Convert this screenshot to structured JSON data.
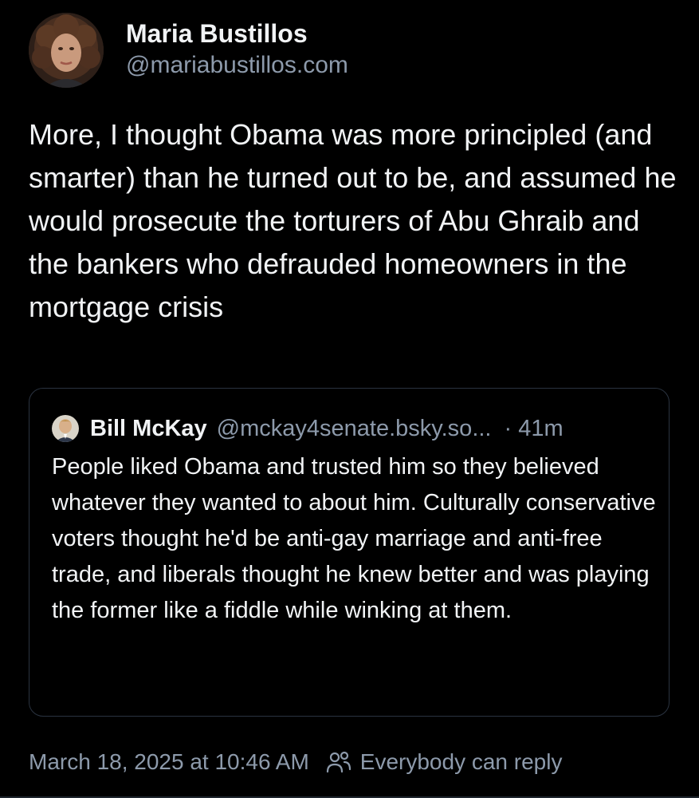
{
  "author": {
    "display_name": "Maria Bustillos",
    "handle": "@mariabustillos.com"
  },
  "post": {
    "text": "More, I thought Obama was more principled (and smarter) than he turned out to be, and assumed he would prosecute the torturers of Abu Ghraib and the bankers who defrauded homeowners in the mortgage crisis"
  },
  "quoted_post": {
    "display_name": "Bill McKay",
    "handle": "@mckay4senate.bsky.so...",
    "time": "· 41m",
    "text": "People liked Obama and trusted him so they believed whatever they wanted to about him. Culturally conservative voters thought he'd be anti-gay marriage and anti-free trade, and liberals thought he knew better and was playing the former like a fiddle while winking at them."
  },
  "footer": {
    "timestamp": "March 18, 2025 at 10:46 AM",
    "reply_setting": "Everybody can reply",
    "icon": "people-icon"
  },
  "colors": {
    "background": "#000000",
    "text": "#f1f3f5",
    "muted": "#8d9aab",
    "border": "#2a3340"
  }
}
